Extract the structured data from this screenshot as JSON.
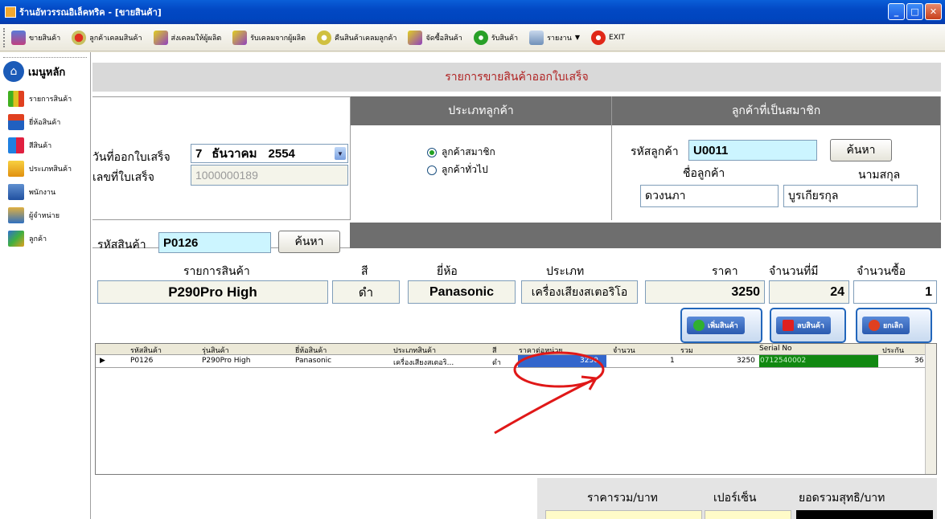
{
  "window": {
    "title": "ร้านอัทวรรณอิเล็คทริค - [ขายสินค้า]"
  },
  "toolbar": [
    {
      "label": "ขายสินค้า",
      "icon": "truck-icon"
    },
    {
      "label": "ลูกค้าเคลมสินค้า",
      "icon": "gear-warning-icon"
    },
    {
      "label": "ส่งเคลมให้ผู้ผลิต",
      "icon": "arrow-icon"
    },
    {
      "label": "รับเคลมจากผู้ผลิต",
      "icon": "arrow-icon"
    },
    {
      "label": "คืนสินค้าเคลมลูกค้า",
      "icon": "gear-icon"
    },
    {
      "label": "จัดซื้อสินค้า",
      "icon": "arrow-icon"
    },
    {
      "label": "รับสินค้า",
      "icon": "recycle-icon"
    },
    {
      "label": "รายงาน",
      "icon": "printer-icon"
    },
    {
      "label": "EXIT",
      "icon": "stop-icon"
    }
  ],
  "sidebar": {
    "main_label": "เมนูหลัก",
    "items": [
      {
        "label": "รายการสินค้า",
        "icon": "chart-icon"
      },
      {
        "label": "ยี่ห้อสินค้า",
        "icon": "network-icon"
      },
      {
        "label": "สีสินค้า",
        "icon": "color-icon"
      },
      {
        "label": "ประเภทสินค้า",
        "icon": "box-icon"
      },
      {
        "label": "พนักงาน",
        "icon": "person-icon"
      },
      {
        "label": "ผู้จำหน่าย",
        "icon": "group-icon"
      },
      {
        "label": "ลูกค้า",
        "icon": "customer-icon"
      }
    ]
  },
  "header": {
    "title": "รายการขายสินค้าออกใบเสร็จ"
  },
  "receipt": {
    "date_label": "วันที่ออกใบเสร็จ",
    "date_day": "7",
    "date_month": "ธันวาคม",
    "date_year": "2554",
    "no_label": "เลขที่ใบเสร็จ",
    "no_value": "1000000189"
  },
  "customer_type": {
    "title": "ประเภทลูกค้า",
    "option_member": "ลูกค้าสมาชิก",
    "option_general": "ลูกค้าทั่วไป",
    "selected": "member"
  },
  "member": {
    "title": "ลูกค้าที่เป็นสมาชิก",
    "code_label": "รหัสลูกค้า",
    "code_value": "U0011",
    "search_label": "ค้นหา",
    "name_label": "ชื่อลูกค้า",
    "surname_label": "นามสกุล",
    "name_value": "ดวงนภา",
    "surname_value": "บูรเกียรกุล"
  },
  "product": {
    "code_label": "รหัสสินค้า",
    "code_value": "P0126",
    "search_label": "ค้นหา",
    "col_item": "รายการสินค้า",
    "col_color": "สี",
    "col_brand": "ยี่ห้อ",
    "col_type": "ประเภท",
    "col_price": "ราคา",
    "col_stock": "จำนวนที่มี",
    "col_qty": "จำนวนซื้อ",
    "item_value": "P290Pro High",
    "color_value": "ดำ",
    "brand_value": "Panasonic",
    "type_value": "เครื่องเสียงสเตอริโอ",
    "price_value": "3250",
    "stock_value": "24",
    "qty_value": "1"
  },
  "actions": {
    "add": "เพิ่มสินค้า",
    "remove": "ลบสินค้า",
    "cancel": "ยกเลิก"
  },
  "grid": {
    "headers": [
      "รหัสสินค้า",
      "รุ่นสินค้า",
      "ยี่ห้อสินค้า",
      "ประเภทสินค้า",
      "สี",
      "ราคาต่อหน่วย",
      "จำนวน",
      "รวม",
      "Serial No",
      "ประกัน"
    ],
    "row": {
      "code": "P0126",
      "model": "P290Pro High",
      "brand": "Panasonic",
      "type": "เครื่องเสียงสเตอริ...",
      "color": "ดำ",
      "unit_price": "3250",
      "qty": "1",
      "total": "3250",
      "serial": "0712540002",
      "warranty": "36"
    }
  },
  "totals": {
    "sum_label": "ราคารวม/บาท",
    "percent_label": "เปอร์เซ็น",
    "net_label": "ยอดรวมสุทธิ/บาท"
  }
}
